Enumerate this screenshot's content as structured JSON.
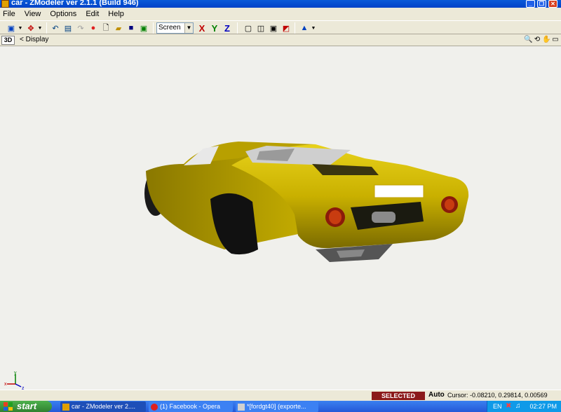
{
  "window": {
    "title": "car - ZModeler ver 2.1.1 (Build 946)",
    "buttons": [
      "_",
      "❐",
      "✕"
    ]
  },
  "menu": [
    "File",
    "View",
    "Options",
    "Edit",
    "Help"
  ],
  "toolbar": {
    "coord_mode": "Screen",
    "axes": [
      "X",
      "Y",
      "Z"
    ],
    "axis_colors": [
      "#c00000",
      "#008000",
      "#0000c0"
    ]
  },
  "viewbar": {
    "view_label": "3D",
    "display_label": "< Display"
  },
  "viewport": {
    "gizmo_labels": [
      "y",
      "x",
      "z"
    ],
    "model_color": "#d4b800"
  },
  "status": {
    "mode": "SELECTED MODE",
    "auto": "Auto",
    "cursor": "Cursor: -0.08210, 0.29814, 0.00569"
  },
  "taskbar": {
    "start": "start",
    "tasks": [
      {
        "label": "car - ZModeler ver 2...."
      },
      {
        "label": "(1) Facebook - Opera"
      },
      {
        "label": "*[fordgt40] (exporte..."
      }
    ],
    "language": "EN",
    "clock": "02:27 PM"
  }
}
